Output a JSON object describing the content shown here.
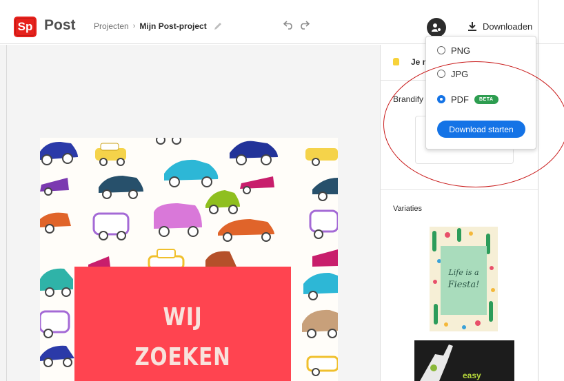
{
  "app": {
    "logo_letters": "Sp",
    "name": "Post",
    "brand_color": "#e6211c"
  },
  "breadcrumb": {
    "projects_label": "Projecten",
    "separator": "›",
    "current_project": "Mijn Post-project"
  },
  "toolbar": {
    "undo_icon": "undo-icon",
    "redo_icon": "redo-icon",
    "download_label": "Downloaden"
  },
  "download_menu": {
    "options": [
      {
        "label": "PNG",
        "selected": false
      },
      {
        "label": "JPG",
        "selected": false
      },
      {
        "label": "PDF",
        "selected": true,
        "badge": "BETA"
      }
    ],
    "start_button_label": "Download starten",
    "accent_color": "#1473e6",
    "badge_color": "#2d9d50"
  },
  "panel": {
    "truncated_heading": "Je m",
    "brandify_label": "Brandify",
    "variaties_label": "Variaties",
    "variation_1": {
      "line1": "Life is a",
      "line2": "Fiesta!"
    },
    "variation_2": {
      "text": "easy"
    }
  },
  "artwork": {
    "headline_line1": "WIJ",
    "headline_line2": "ZOEKEN",
    "headline_box_color": "#ff4450"
  }
}
